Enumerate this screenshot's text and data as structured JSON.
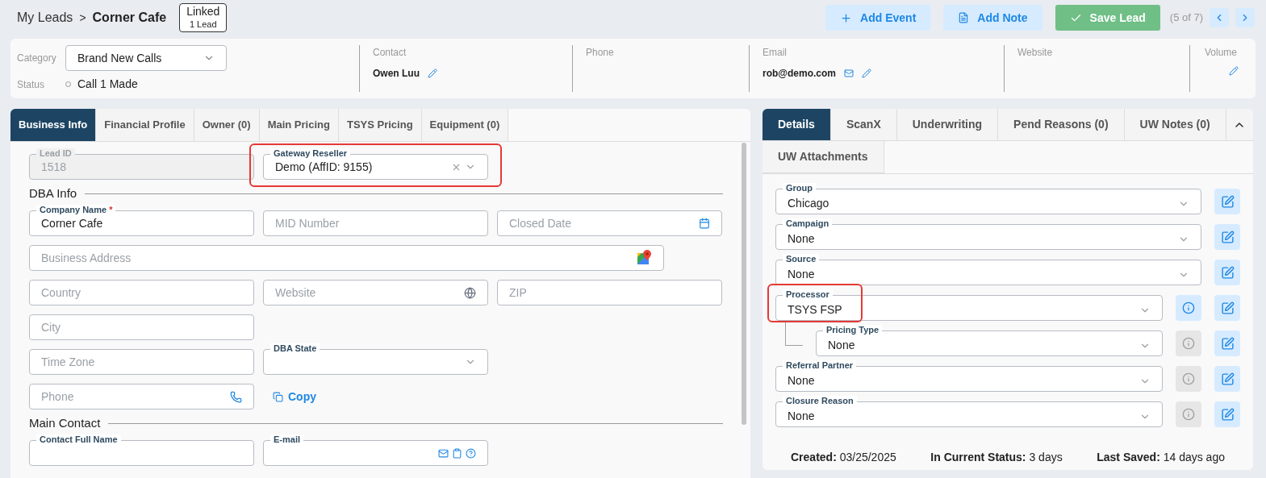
{
  "breadcrumb": {
    "parent": "My Leads",
    "separator": ">",
    "current": "Corner Cafe"
  },
  "linked_badge": {
    "title": "Linked",
    "count": "1 Lead"
  },
  "actions": [
    {
      "label": "Add Event",
      "kind": "add"
    },
    {
      "label": "Add Note",
      "kind": "note"
    },
    {
      "label": "Save Lead",
      "kind": "save"
    }
  ],
  "pager": {
    "position": "(5 of 7)"
  },
  "summary": {
    "category": {
      "label": "Category",
      "value": "Brand New Calls"
    },
    "status": {
      "label": "Status",
      "value": "Call 1 Made"
    },
    "columns": [
      {
        "label": "Contact",
        "value": "Owen Luu",
        "kind": "contact"
      },
      {
        "label": "Phone",
        "kind": "empty"
      },
      {
        "label": "Email",
        "value": "rob@demo.com",
        "kind": "email"
      },
      {
        "label": "Website",
        "kind": "empty"
      },
      {
        "label": "Volume",
        "kind": "volume"
      }
    ]
  },
  "left_tabs": [
    {
      "label": "Business Info",
      "selected": true
    },
    {
      "label": "Financial Profile",
      "selected": false
    },
    {
      "label": "Owner (0)",
      "selected": false
    },
    {
      "label": "Main Pricing",
      "selected": false
    },
    {
      "label": "TSYS Pricing",
      "selected": false
    },
    {
      "label": "Equipment (0)",
      "selected": false
    }
  ],
  "business_form": [
    {
      "kind": "row",
      "fields": [
        {
          "kind": "disabled",
          "label": "Lead ID",
          "value": "1518"
        },
        {
          "kind": "clearable",
          "label": "Gateway Reseller",
          "value": "Demo (AffID: 9155)",
          "highlighted": true
        }
      ]
    },
    {
      "kind": "section",
      "title": "DBA Info"
    },
    {
      "kind": "row",
      "fields": [
        {
          "kind": "text",
          "label": "Company Name",
          "required_mark": "*",
          "value": "Corner Cafe"
        },
        {
          "kind": "text",
          "placeholder": "MID Number"
        },
        {
          "kind": "date",
          "placeholder": "Closed Date"
        }
      ]
    },
    {
      "kind": "row",
      "fields": [
        {
          "kind": "address",
          "placeholder": "Business Address"
        }
      ]
    },
    {
      "kind": "row",
      "fields": [
        {
          "kind": "text",
          "placeholder": "Country"
        },
        {
          "kind": "website",
          "placeholder": "Website"
        },
        {
          "kind": "text",
          "placeholder": "ZIP"
        }
      ]
    },
    {
      "kind": "row",
      "fields": [
        {
          "kind": "text",
          "placeholder": "City"
        }
      ]
    },
    {
      "kind": "row",
      "fields": [
        {
          "kind": "text",
          "placeholder": "Time Zone"
        },
        {
          "kind": "select",
          "label": "DBA State"
        }
      ]
    },
    {
      "kind": "row",
      "fields": [
        {
          "kind": "phone",
          "placeholder": "Phone"
        },
        {
          "kind": "copy",
          "label": "Copy"
        }
      ]
    },
    {
      "kind": "section",
      "title": "Main Contact"
    },
    {
      "kind": "row",
      "fields": [
        {
          "kind": "text",
          "label": "Contact Full Name"
        },
        {
          "kind": "email",
          "label": "E-mail"
        }
      ]
    }
  ],
  "right_tabs": [
    {
      "label": "Details",
      "selected": true
    },
    {
      "label": "ScanX",
      "selected": false
    },
    {
      "label": "Underwriting",
      "selected": false
    },
    {
      "label": "Pend Reasons (0)",
      "selected": false
    },
    {
      "label": "UW Notes (0)",
      "selected": false
    },
    {
      "label": "UW Attachments",
      "selected": false
    }
  ],
  "details": [
    {
      "kind": "select",
      "label": "Group",
      "value": "Chicago"
    },
    {
      "kind": "select",
      "label": "Campaign",
      "value": "None"
    },
    {
      "kind": "select",
      "label": "Source",
      "value": "None"
    },
    {
      "kind": "select-info",
      "label": "Processor",
      "value": "TSYS FSP",
      "info_enabled": true,
      "highlighted": true,
      "children": [
        {
          "kind": "select-info",
          "label": "Pricing Type",
          "value": "None",
          "info_enabled": false
        }
      ]
    },
    {
      "kind": "select-info",
      "label": "Referral Partner",
      "value": "None",
      "info_enabled": false
    },
    {
      "kind": "select-info",
      "label": "Closure Reason",
      "value": "None",
      "info_enabled": false
    }
  ],
  "footer": [
    {
      "label": "Created:",
      "value": "03/25/2025"
    },
    {
      "label": "In Current Status:",
      "value": "3 days"
    },
    {
      "label": "Last Saved:",
      "value": "14 days ago"
    }
  ]
}
